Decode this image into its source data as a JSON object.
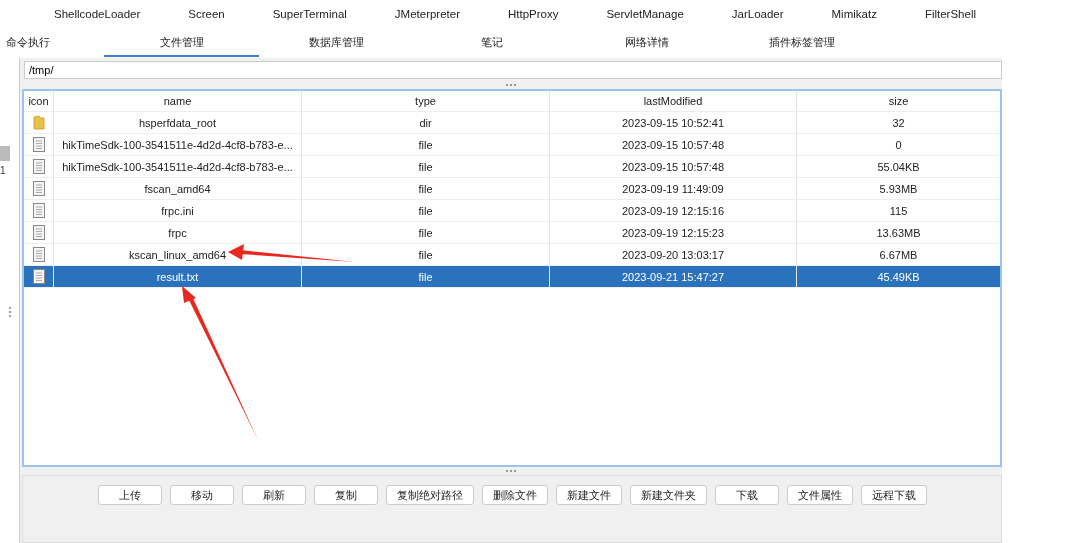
{
  "plugin_tabs": [
    "ShellcodeLoader",
    "Screen",
    "SuperTerminal",
    "JMeterpreter",
    "HttpProxy",
    "ServletManage",
    "JarLoader",
    "Mimikatz",
    "FilterShell"
  ],
  "tabs": [
    {
      "label": "命令执行",
      "selected": false
    },
    {
      "label": "文件管理",
      "selected": true
    },
    {
      "label": "数据库管理",
      "selected": false
    },
    {
      "label": "笔记",
      "selected": false
    },
    {
      "label": "网络详情",
      "selected": false
    },
    {
      "label": "插件标签管理",
      "selected": false
    }
  ],
  "path": {
    "value": "/tmp/"
  },
  "table": {
    "columns": [
      "icon",
      "name",
      "type",
      "lastModified",
      "size"
    ],
    "rows": [
      {
        "kind": "dir",
        "name": "hsperfdata_root",
        "type": "dir",
        "lastModified": "2023-09-15 10:52:41",
        "size": "32",
        "selected": false
      },
      {
        "kind": "file",
        "name": "hikTimeSdk-100-3541511e-4d2d-4cf8-b783-e...",
        "type": "file",
        "lastModified": "2023-09-15 10:57:48",
        "size": "0",
        "selected": false
      },
      {
        "kind": "file",
        "name": "hikTimeSdk-100-3541511e-4d2d-4cf8-b783-e...",
        "type": "file",
        "lastModified": "2023-09-15 10:57:48",
        "size": "55.04KB",
        "selected": false
      },
      {
        "kind": "file",
        "name": "fscan_amd64",
        "type": "file",
        "lastModified": "2023-09-19 11:49:09",
        "size": "5.93MB",
        "selected": false
      },
      {
        "kind": "file",
        "name": "frpc.ini",
        "type": "file",
        "lastModified": "2023-09-19 12:15:16",
        "size": "115",
        "selected": false
      },
      {
        "kind": "file",
        "name": "frpc",
        "type": "file",
        "lastModified": "2023-09-19 12:15:23",
        "size": "13.63MB",
        "selected": false
      },
      {
        "kind": "file",
        "name": "kscan_linux_amd64",
        "type": "file",
        "lastModified": "2023-09-20 13:03:17",
        "size": "6.67MB",
        "selected": false
      },
      {
        "kind": "file",
        "name": "result.txt",
        "type": "file",
        "lastModified": "2023-09-21 15:47:27",
        "size": "45.49KB",
        "selected": true
      }
    ]
  },
  "buttons": [
    "上传",
    "移动",
    "刷新",
    "复制",
    "复制绝对路径",
    "删除文件",
    "新建文件",
    "新建文件夹",
    "下载",
    "文件属性",
    "远程下载"
  ],
  "side_label": "1"
}
